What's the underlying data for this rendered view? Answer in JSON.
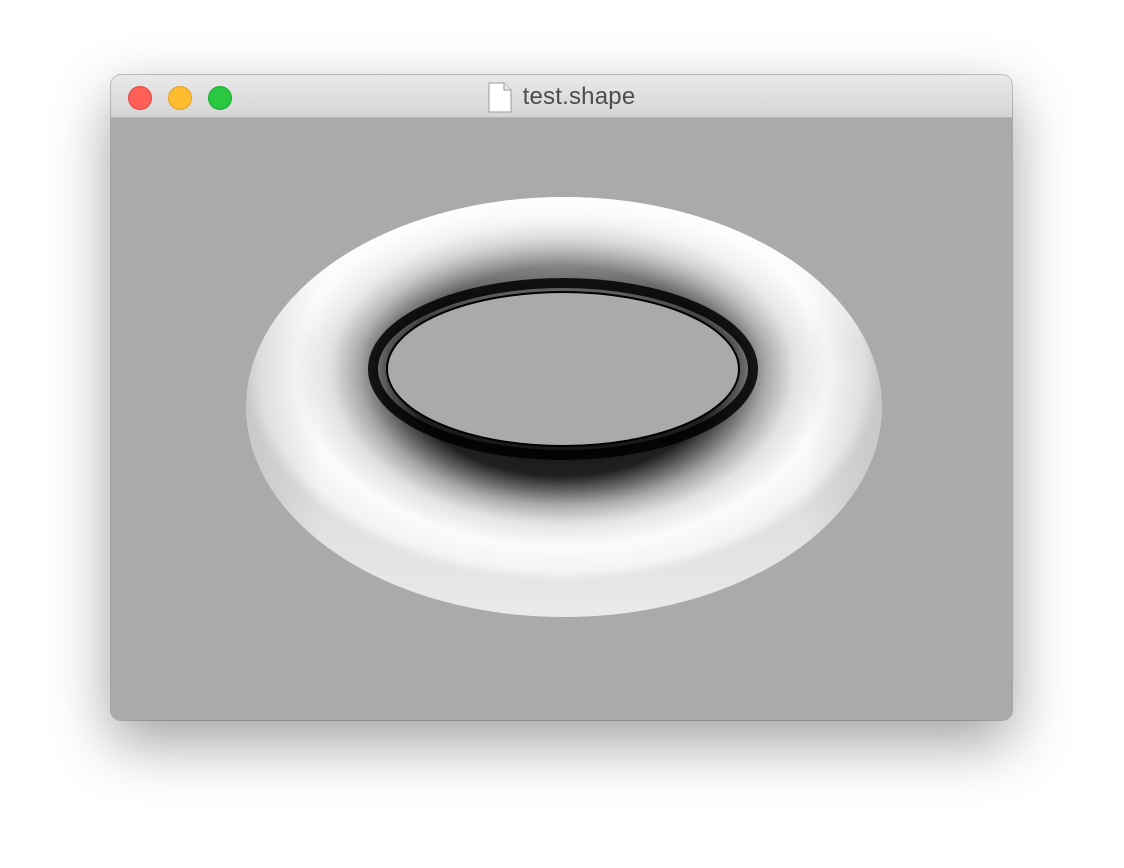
{
  "window": {
    "title": "test.shape",
    "title_icon": "document-icon",
    "controls": [
      "close",
      "minimize",
      "zoom"
    ]
  },
  "viewport": {
    "background_color": "#aaaaaa",
    "shape": "torus",
    "shape_color": "#ffffff"
  }
}
